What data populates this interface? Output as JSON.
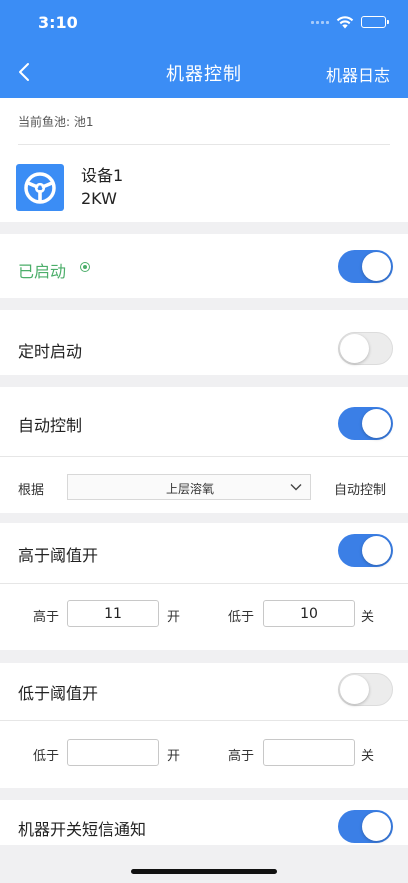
{
  "status_bar": {
    "time": "3:10"
  },
  "nav": {
    "title": "机器控制",
    "right_label": "机器日志"
  },
  "pond": {
    "label": "当前鱼池: 池1"
  },
  "device": {
    "name": "设备1",
    "power": "2KW"
  },
  "started": {
    "label": "已启动",
    "on": true,
    "status_color": "#4cae6a"
  },
  "timed_start": {
    "label": "定时启动",
    "on": false
  },
  "auto_control": {
    "label": "自动控制",
    "on": true,
    "basis_label": "根据",
    "basis_value": "上层溶氧",
    "suffix": "自动控制"
  },
  "above_threshold": {
    "label": "高于阈值开",
    "on": true,
    "left_label": "高于",
    "left_value": "11",
    "left_action": "开",
    "right_label": "低于",
    "right_value": "10",
    "right_action": "关"
  },
  "below_threshold": {
    "label": "低于阈值开",
    "on": false,
    "left_label": "低于",
    "left_value": "",
    "left_action": "开",
    "right_label": "高于",
    "right_value": "",
    "right_action": "关"
  },
  "sms_notify": {
    "label": "机器开关短信通知",
    "on": true
  },
  "colors": {
    "brand": "#3b8df5",
    "toggle_on": "#3b7fe6",
    "background": "#f0f0f2"
  },
  "icons": [
    "back-arrow-icon",
    "wifi-icon",
    "battery-icon",
    "steering-wheel-icon",
    "chevron-down-icon"
  ]
}
